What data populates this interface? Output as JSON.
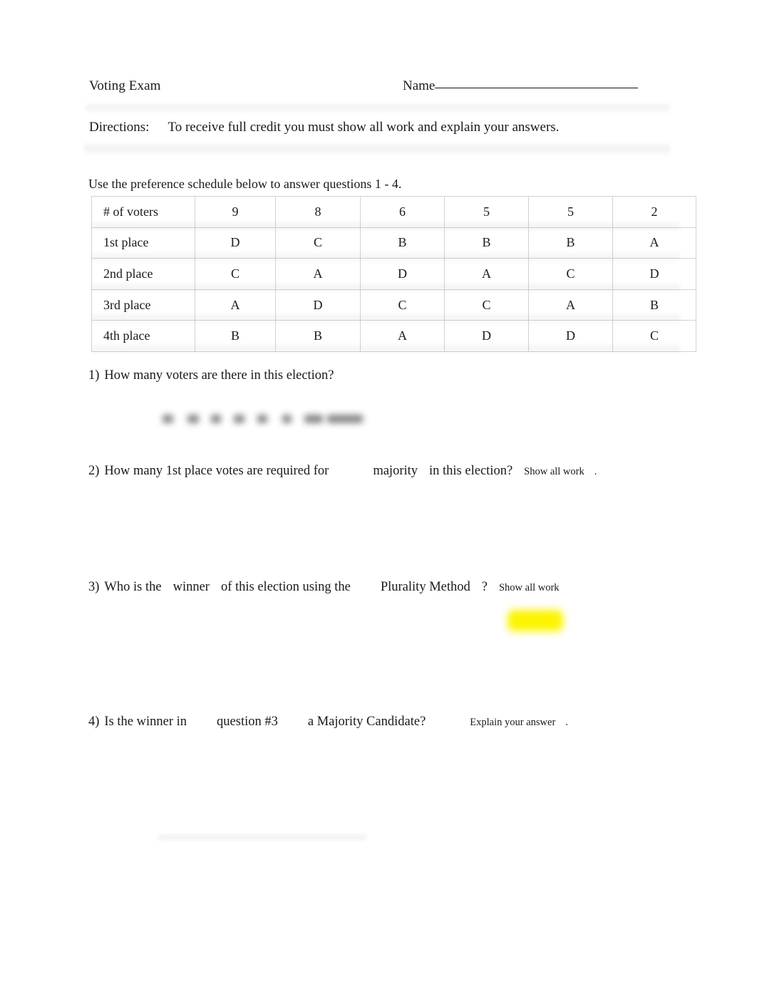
{
  "document": {
    "title": "Voting Exam",
    "name_label": "Name",
    "name_value": "",
    "directions_label": "Directions:",
    "directions_text": "To receive full credit you must show all work and explain your answers.",
    "table_intro": "Use the preference schedule below to answer questions 1 - 4."
  },
  "preference_schedule": {
    "row_labels": [
      "# of voters",
      "1st place",
      "2nd place",
      "3rd place",
      "4th place"
    ],
    "voter_counts": [
      "9",
      "8",
      "6",
      "5",
      "5",
      "2"
    ],
    "rows": [
      {
        "label": "1st place",
        "values": [
          "D",
          "C",
          "B",
          "B",
          "B",
          "A"
        ]
      },
      {
        "label": "2nd place",
        "values": [
          "C",
          "A",
          "D",
          "A",
          "C",
          "D"
        ]
      },
      {
        "label": "3rd place",
        "values": [
          "A",
          "D",
          "C",
          "C",
          "A",
          "B"
        ]
      },
      {
        "label": "4th place",
        "values": [
          "B",
          "B",
          "A",
          "D",
          "D",
          "C"
        ]
      }
    ]
  },
  "questions": [
    {
      "number": "1)",
      "part1": "How many voters are there in this election?",
      "part2": "",
      "part3": "",
      "part4": "",
      "note": "",
      "trailing": ""
    },
    {
      "number": "2)",
      "part1": "How many 1st place votes are required for",
      "part2": "majority",
      "part3": "in this election?",
      "part4": "",
      "note": "Show all work",
      "trailing": "."
    },
    {
      "number": "3)",
      "part1": "Who is the",
      "part2": "winner",
      "part3": "of this election using the",
      "part4": "Plurality Method",
      "question_mark": "?",
      "note": "Show all work",
      "trailing": ""
    },
    {
      "number": "4)",
      "part1": "Is the winner in",
      "part2": "question #3",
      "part3": "a Majority Candidate?",
      "part4": "",
      "note": "Explain your answer",
      "trailing": "."
    }
  ],
  "annotations": {
    "q1_answer_redacted": "",
    "q3_highlight_color": "#fcf400",
    "bottom_smudge": ""
  }
}
